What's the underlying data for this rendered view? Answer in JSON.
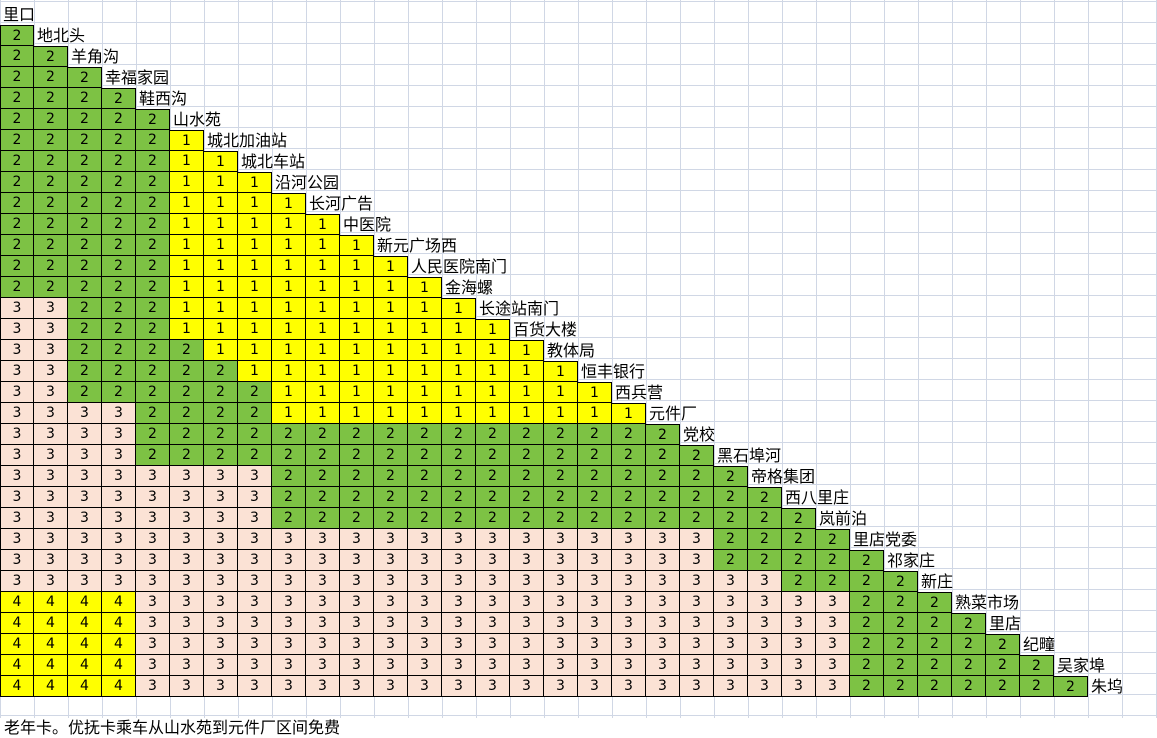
{
  "stations": [
    "里口",
    "地北头",
    "羊角沟",
    "幸福家园",
    "鞋西沟",
    "山水苑",
    "城北加油站",
    "城北车站",
    "沿河公园",
    "长河广告",
    "中医院",
    "新元广场西",
    "人民医院南门",
    "金海螺",
    "长途站南门",
    "百货大楼",
    "教体局",
    "恒丰银行",
    "西兵营",
    "元件厂",
    "党校",
    "黑石埠河",
    "帝格集团",
    "西八里庄",
    "岚前泊",
    "里店党委",
    "祁家庄",
    "新庄",
    "熟菜市场",
    "里店",
    "纪疃",
    "吴家埠",
    "朱坞"
  ],
  "fare_rows": [
    "2",
    "22",
    "222",
    "2222",
    "22222",
    "222221",
    "2222211",
    "22222111",
    "222221111",
    "2222211111",
    "22222111111",
    "222221111111",
    "2222211111111",
    "33222111111111",
    "332221111111111",
    "3322221111111111",
    "33222221111111111",
    "332222221111111111",
    "3333222211111111111",
    "33332222222222222222",
    "333322222222222222222",
    "3333333322222222222222",
    "33333333222222222222222",
    "333333332222222222222222",
    "3333333333333333333332222",
    "33333333333333333333322222",
    "333333333333333333333332222",
    "4444333333333333333333333222",
    "44443333333333333333333332222",
    "444433333333333333333333322222",
    "4444333333333333333333333222222",
    "44443333333333333333333332222222"
  ],
  "colors": {
    "fare_1": "#ffff00",
    "fare_2": "#7dc244",
    "fare_3": "#fbe2d5",
    "fare_4": "#ffff00"
  },
  "note": "老年卡。优抚卡乘车从山水苑到元件厂区间免费"
}
